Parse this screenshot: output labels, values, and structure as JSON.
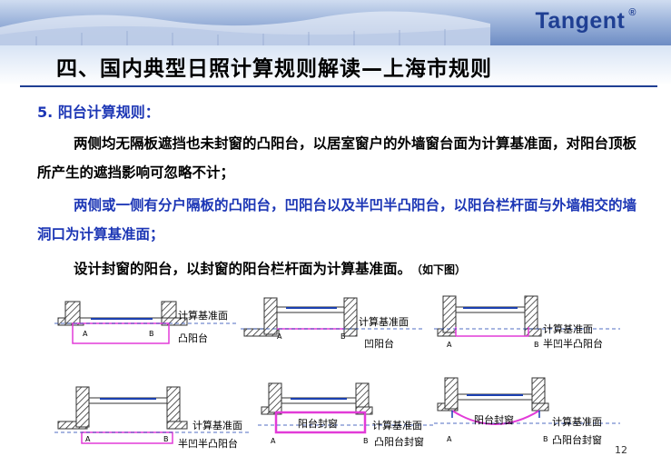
{
  "header": {
    "brand": "Tangent",
    "brand_mark": "®"
  },
  "title": "四、国内典型日照计算规则解读—上海市规则",
  "section": {
    "heading": "5. 阳台计算规则：",
    "paragraphs": [
      "两侧均无隔板遮挡也未封窗的凸阳台，以居室窗户的外墙窗台面为计算基准面，对阳台顶板所产生的遮挡影响可忽略不计；",
      "两侧或一侧有分户隔板的凸阳台，凹阳台以及半凹半凸阳台，以阳台栏杆面与外墙相交的墙洞口为计算基准面；",
      "设计封窗的阳台，以封窗的阳台栏杆面为计算基准面。"
    ],
    "note": "（如下图）"
  },
  "figures": [
    {
      "plane_label": "计算基准面",
      "type_label": "凸阳台",
      "point_a": "A",
      "point_b": "B"
    },
    {
      "plane_label": "计算基准面",
      "type_label": "凹阳台",
      "point_a": "A",
      "point_b": "B"
    },
    {
      "plane_label": "计算基准面",
      "type_label": "半凹半凸阳台",
      "point_a": "A",
      "point_b": "B"
    },
    {
      "plane_label": "计算基准面",
      "type_label": "半凹半凸阳台",
      "point_a": "A",
      "point_b": "B"
    },
    {
      "plane_label": "计算基准面",
      "type_label": "凸阳台封窗",
      "inner_label": "阳台封窗",
      "point_a": "A",
      "point_b": "B"
    },
    {
      "plane_label": "计算基准面",
      "type_label": "凸阳台封窗",
      "inner_label": "阳台封窗",
      "point_a": "A",
      "point_b": "B"
    }
  ],
  "footer": {
    "page_number": "12"
  },
  "colors": {
    "brand": "#1f3f93",
    "highlight_text": "#1c36b5",
    "balcony_outline": "#e23bd8",
    "glass": "#1a3fb0"
  }
}
